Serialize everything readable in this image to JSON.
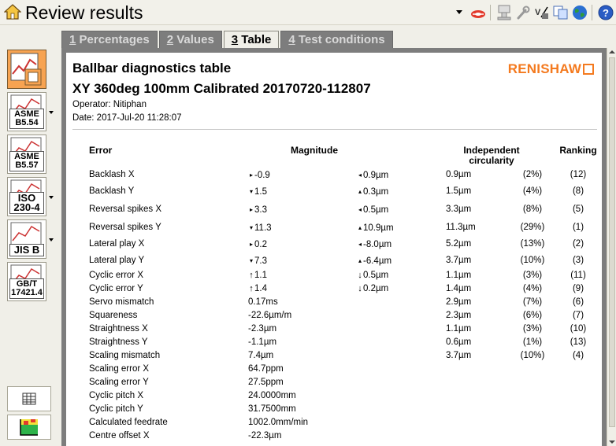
{
  "window": {
    "title": "Review results"
  },
  "tabs": [
    {
      "num": "1",
      "label": " Percentages"
    },
    {
      "num": "2",
      "label": " Values"
    },
    {
      "num": "3",
      "label": " Table"
    },
    {
      "num": "4",
      "label": " Test conditions"
    }
  ],
  "left_toolbar": {
    "standards": [
      "ASME B5.54",
      "ASME B5.57",
      "ISO 230-4",
      "JIS B",
      "GB/T 17421.4"
    ],
    "standard_labels": [
      [
        "ASME",
        "B5.54"
      ],
      [
        "ASME",
        "B5.57"
      ],
      [
        "ISO",
        "230-4"
      ],
      [
        "JIS B",
        ""
      ],
      [
        "GB/T",
        "17421.4"
      ]
    ]
  },
  "report": {
    "title": "Ballbar diagnostics table",
    "subtitle": "XY 360deg 100mm Calibrated 20170720-112807",
    "operator": "Operator: Nitiphan",
    "date": "Date: 2017-Jul-20 11:28:07",
    "brand": "RENISHAW"
  },
  "table": {
    "headers": {
      "error": "Error",
      "magnitude": "Magnitude",
      "independent_circularity": "Independent circularity",
      "ranking": "Ranking"
    },
    "rows": [
      {
        "name": "Backlash X",
        "a1": "right",
        "m1": "-0.9",
        "a2": "left",
        "m2": "0.9µm",
        "ic": "0.9µm",
        "pct": "(2%)",
        "rank": "(12)"
      },
      {
        "name": "Backlash Y",
        "a1": "down",
        "m1": "1.5",
        "a2": "up",
        "m2": "0.3µm",
        "ic": "1.5µm",
        "pct": "(4%)",
        "rank": "(8)"
      },
      {
        "name": "Reversal spikes X",
        "a1": "right",
        "m1": "3.3",
        "a2": "left",
        "m2": "0.5µm",
        "ic": "3.3µm",
        "pct": "(8%)",
        "rank": "(5)"
      },
      {
        "name": "Reversal spikes Y",
        "a1": "down",
        "m1": "11.3",
        "a2": "up",
        "m2": "10.9µm",
        "ic": "11.3µm",
        "pct": "(29%)",
        "rank": "(1)"
      },
      {
        "name": "Lateral play X",
        "a1": "right",
        "m1": "0.2",
        "a2": "left",
        "m2": "-8.0µm",
        "ic": "5.2µm",
        "pct": "(13%)",
        "rank": "(2)"
      },
      {
        "name": "Lateral play Y",
        "a1": "down",
        "m1": "7.3",
        "a2": "up",
        "m2": "-6.4µm",
        "ic": "3.7µm",
        "pct": "(10%)",
        "rank": "(3)"
      },
      {
        "name": "Cyclic error X",
        "a1": "bigup",
        "m1": "1.1",
        "a2": "bigdown",
        "m2": "0.5µm",
        "ic": "1.1µm",
        "pct": "(3%)",
        "rank": "(11)"
      },
      {
        "name": "Cyclic error Y",
        "a1": "bigup",
        "m1": "1.4",
        "a2": "bigdown",
        "m2": "0.2µm",
        "ic": "1.4µm",
        "pct": "(4%)",
        "rank": "(9)"
      },
      {
        "name": "Servo mismatch",
        "a1": "",
        "m1": "0.17ms",
        "a2": "",
        "m2": "",
        "ic": "2.9µm",
        "pct": "(7%)",
        "rank": "(6)"
      },
      {
        "name": "Squareness",
        "a1": "",
        "m1": "-22.6µm/m",
        "a2": "",
        "m2": "",
        "ic": "2.3µm",
        "pct": "(6%)",
        "rank": "(7)"
      },
      {
        "name": "Straightness X",
        "a1": "",
        "m1": "-2.3µm",
        "a2": "",
        "m2": "",
        "ic": "1.1µm",
        "pct": "(3%)",
        "rank": "(10)"
      },
      {
        "name": "Straightness Y",
        "a1": "",
        "m1": "-1.1µm",
        "a2": "",
        "m2": "",
        "ic": "0.6µm",
        "pct": "(1%)",
        "rank": "(13)"
      },
      {
        "name": "Scaling mismatch",
        "a1": "",
        "m1": "7.4µm",
        "a2": "",
        "m2": "",
        "ic": "3.7µm",
        "pct": "(10%)",
        "rank": "(4)"
      },
      {
        "name": "Scaling error X",
        "a1": "",
        "m1": "64.7ppm",
        "a2": "",
        "m2": "",
        "ic": "",
        "pct": "",
        "rank": ""
      },
      {
        "name": "Scaling error Y",
        "a1": "",
        "m1": "27.5ppm",
        "a2": "",
        "m2": "",
        "ic": "",
        "pct": "",
        "rank": ""
      },
      {
        "name": "Cyclic pitch X",
        "a1": "",
        "m1": "24.0000mm",
        "a2": "",
        "m2": "",
        "ic": "",
        "pct": "",
        "rank": ""
      },
      {
        "name": "Cyclic pitch Y",
        "a1": "",
        "m1": "31.7500mm",
        "a2": "",
        "m2": "",
        "ic": "",
        "pct": "",
        "rank": ""
      },
      {
        "name": "Calculated feedrate",
        "a1": "",
        "m1": "1002.0mm/min",
        "a2": "",
        "m2": "",
        "ic": "",
        "pct": "",
        "rank": ""
      },
      {
        "name": "Centre offset X",
        "a1": "",
        "m1": "-22.3µm",
        "a2": "",
        "m2": "",
        "ic": "",
        "pct": "",
        "rank": ""
      }
    ]
  },
  "colors": {
    "accent": "#f47a1f",
    "tab_inactive": "#7d7d7d",
    "panel_bg": "#7d7d7d",
    "selected_button": "#f7a351"
  }
}
